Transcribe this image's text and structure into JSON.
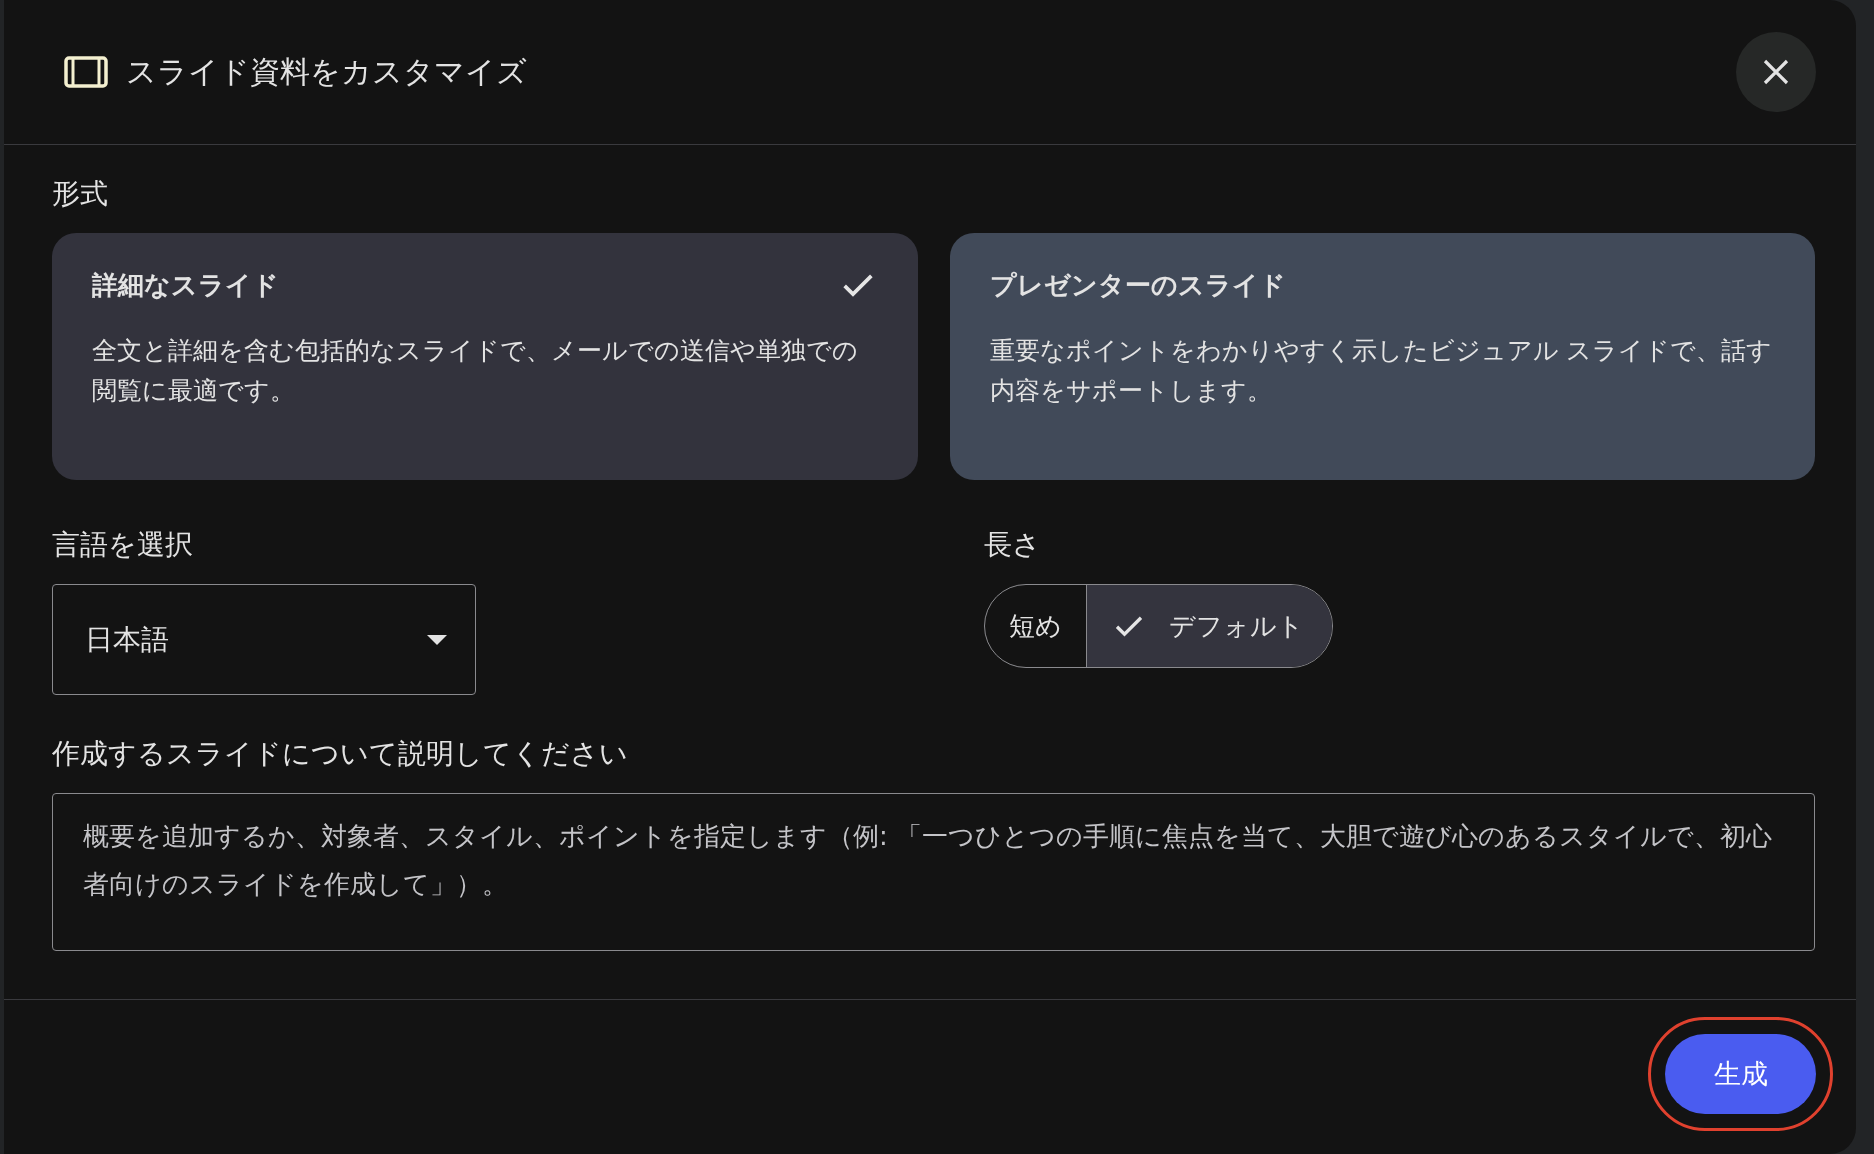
{
  "dialog": {
    "title": "スライド資料をカスタマイズ"
  },
  "format": {
    "label": "形式",
    "options": [
      {
        "title": "詳細なスライド",
        "description": "全文と詳細を含む包括的なスライドで、メールでの送信や単独での閲覧に最適です。",
        "selected": true
      },
      {
        "title": "プレゼンターのスライド",
        "description": "重要なポイントをわかりやすく示したビジュアル スライドで、話す内容をサポートします。",
        "selected": false
      }
    ]
  },
  "language": {
    "label": "言語を選択",
    "value": "日本語"
  },
  "length": {
    "label": "長さ",
    "options": [
      {
        "label": "短め",
        "selected": false
      },
      {
        "label": "デフォルト",
        "selected": true
      }
    ]
  },
  "description": {
    "label": "作成するスライドについて説明してください",
    "placeholder": "概要を追加するか、対象者、スタイル、ポイントを指定します（例: 「一つひとつの手順に焦点を当て、大胆で遊び心のあるスタイルで、初心者向けのスライドを作成して」）。"
  },
  "generate_button": {
    "label": "生成",
    "highlighted": true
  }
}
